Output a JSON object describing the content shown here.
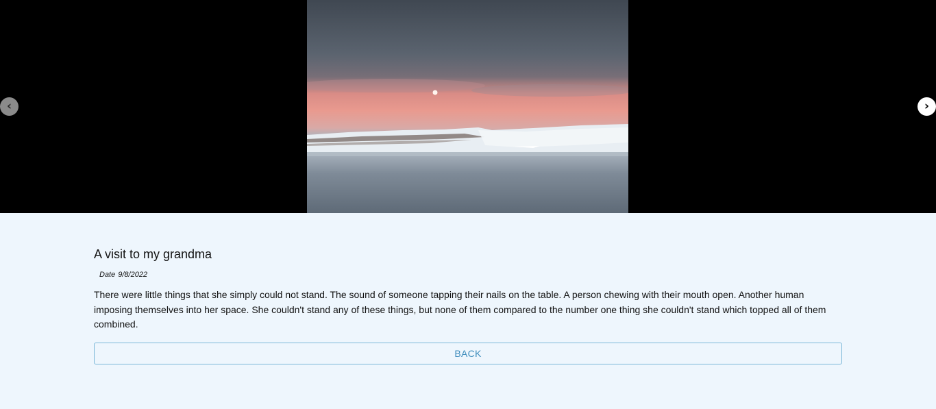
{
  "carousel": {
    "prev_label": "‹",
    "next_label": "›",
    "image_icon": "landscape-photo"
  },
  "post": {
    "title": "A visit to my grandma",
    "date_label": "Date",
    "date_value": "9/8/2022",
    "body": "There were little things that she simply could not stand. The sound of someone tapping their nails on the table. A person chewing with their mouth open. Another human imposing themselves into her space. She couldn't stand any of these things, but none of them compared to the number one thing she couldn't stand which topped all of them combined."
  },
  "actions": {
    "back_label": "BACK"
  },
  "colors": {
    "page_background": "#eef6fd",
    "carousel_background": "#000000",
    "back_button_accent": "#3d8cbc"
  }
}
